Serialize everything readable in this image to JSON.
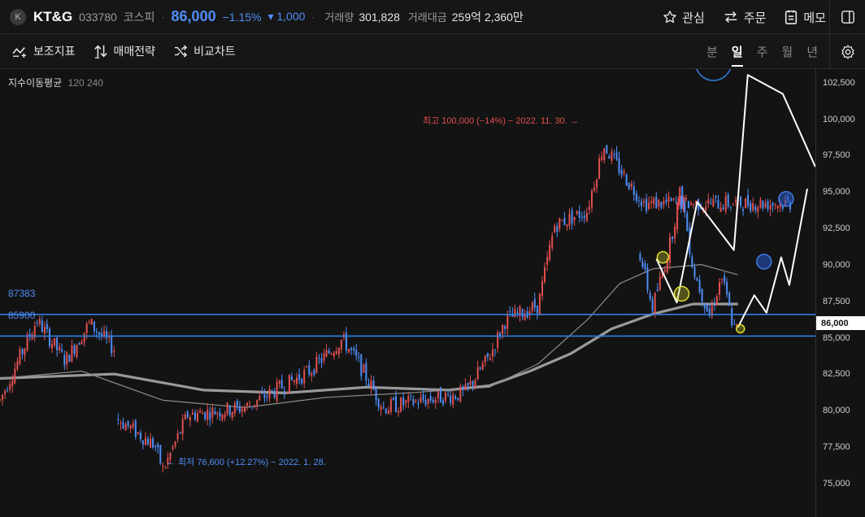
{
  "header": {
    "logo_text": "K",
    "name": "KT&G",
    "code": "033780",
    "market": "코스피",
    "price": "86,000",
    "change_pct": "−1.15%",
    "change_abs": "▾ 1,000",
    "volume_label": "거래량",
    "volume": "301,828",
    "amount_label": "거래대금",
    "amount": "259억 2,360만",
    "btn_watch": "관심",
    "btn_order": "주문",
    "btn_memo": "메모"
  },
  "toolbar": {
    "indicator": "보조지표",
    "strategy": "매매전략",
    "compare": "비교차트",
    "periods": [
      "분",
      "일",
      "주",
      "월",
      "년"
    ],
    "active_period": "일"
  },
  "legend": {
    "name": "지수이동평균",
    "params": "120 240"
  },
  "levels": {
    "upper": "87383",
    "lower": "85900"
  },
  "annotations": {
    "high": "최고 100,000 (−14%) − 2022. 11. 30. →",
    "low": "← 최저 76,600 (+12.27%) − 2022. 1. 28."
  },
  "yaxis": [
    "102,500",
    "100,000",
    "97,500",
    "95,000",
    "92,500",
    "90,000",
    "87,500",
    "85,000",
    "82,500",
    "80,000",
    "77,500",
    "75,000"
  ],
  "current_price_label": "86,000",
  "colors": {
    "up": "#e35050",
    "down": "#4f8ef7",
    "level": "#2f7fe0",
    "ma_short": "#8c8c8c",
    "ma_long": "#9a9a9a",
    "bg": "#131313"
  },
  "chart_data": {
    "type": "candlestick",
    "y_unit": "KRW",
    "ylim": [
      73500,
      104200
    ],
    "segments": [
      {
        "from": 0,
        "to": 0.14,
        "start": 81500,
        "anchors": [
          [
            0,
            81500
          ],
          [
            0.045,
            87000
          ],
          [
            0.08,
            84200
          ],
          [
            0.11,
            86800
          ],
          [
            0.14,
            85000
          ]
        ]
      },
      {
        "from": 0.145,
        "to": 0.97,
        "start": 80200,
        "anchors": [
          [
            0.145,
            80200
          ],
          [
            0.19,
            78400
          ],
          [
            0.2,
            76700
          ],
          [
            0.23,
            80500
          ],
          [
            0.3,
            81000
          ],
          [
            0.38,
            83500
          ],
          [
            0.42,
            85700
          ],
          [
            0.44,
            84000
          ],
          [
            0.47,
            81000
          ],
          [
            0.52,
            81500
          ],
          [
            0.57,
            82000
          ],
          [
            0.6,
            84500
          ],
          [
            0.62,
            87000
          ],
          [
            0.66,
            88000
          ],
          [
            0.68,
            93500
          ],
          [
            0.72,
            94500
          ],
          [
            0.74,
            99000
          ],
          [
            0.77,
            96500
          ],
          [
            0.79,
            95000
          ]
        ]
      },
      {
        "from": 0.785,
        "to": 0.905,
        "start": 91500,
        "anchors": [
          [
            0.785,
            91500
          ],
          [
            0.8,
            87800
          ],
          [
            0.82,
            91800
          ],
          [
            0.835,
            96000
          ],
          [
            0.85,
            90500
          ],
          [
            0.87,
            87300
          ],
          [
            0.885,
            90000
          ],
          [
            0.9,
            86400
          ]
        ]
      }
    ],
    "ma_short": [
      [
        0,
        83000
      ],
      [
        0.1,
        83500
      ],
      [
        0.2,
        81500
      ],
      [
        0.3,
        81000
      ],
      [
        0.4,
        81700
      ],
      [
        0.5,
        82000
      ],
      [
        0.6,
        82400
      ],
      [
        0.66,
        84000
      ],
      [
        0.72,
        87000
      ],
      [
        0.76,
        89500
      ],
      [
        0.8,
        90500
      ],
      [
        0.86,
        90800
      ],
      [
        0.905,
        90100
      ]
    ],
    "ma_long": [
      [
        0,
        83000
      ],
      [
        0.14,
        83300
      ],
      [
        0.25,
        82200
      ],
      [
        0.35,
        82000
      ],
      [
        0.45,
        82400
      ],
      [
        0.55,
        82200
      ],
      [
        0.6,
        82500
      ],
      [
        0.65,
        83500
      ],
      [
        0.7,
        84700
      ],
      [
        0.75,
        86400
      ],
      [
        0.8,
        87400
      ],
      [
        0.85,
        88100
      ],
      [
        0.905,
        88100
      ]
    ],
    "forecast_line": [
      [
        0.805,
        91200
      ],
      [
        0.83,
        88200
      ],
      [
        0.855,
        95100
      ],
      [
        0.9,
        91800
      ],
      [
        0.917,
        103800
      ],
      [
        0.96,
        102500
      ],
      [
        1.0,
        97500
      ]
    ],
    "forecast_line2": [
      [
        0.905,
        86500
      ],
      [
        0.925,
        88700
      ],
      [
        0.94,
        87500
      ],
      [
        0.958,
        91300
      ],
      [
        0.968,
        89400
      ],
      [
        0.99,
        96000
      ]
    ],
    "markers": [
      {
        "x": 0.813,
        "y": 91300,
        "r": 7,
        "color": "yellow"
      },
      {
        "x": 0.836,
        "y": 88800,
        "r": 9,
        "color": "yellow"
      },
      {
        "x": 0.908,
        "y": 86400,
        "r": 5,
        "color": "yellow"
      },
      {
        "x": 0.937,
        "y": 91000,
        "r": 9,
        "color": "blue"
      },
      {
        "x": 0.964,
        "y": 95300,
        "r": 9,
        "color": "blue"
      }
    ]
  }
}
